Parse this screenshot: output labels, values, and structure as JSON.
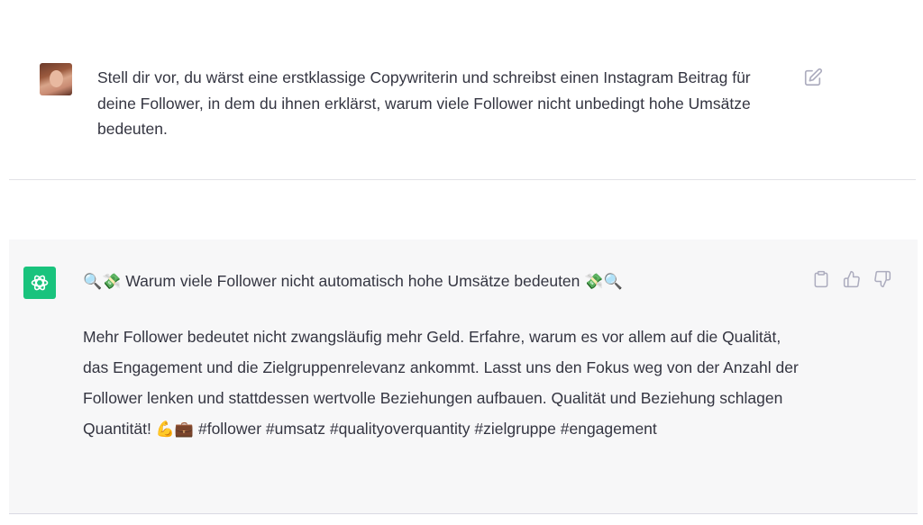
{
  "user_message": {
    "text": "Stell dir vor, du wärst eine erstklassige Copywriterin und schreibst einen Instagram Beitrag für deine Follower, in dem du ihnen erklärst, warum viele Follower nicht unbedingt hohe Umsätze bedeuten."
  },
  "assistant_message": {
    "title_emoji_left": "🔍💸",
    "title_text": "Warum viele Follower nicht automatisch hohe Umsätze bedeuten",
    "title_emoji_right": "💸🔍",
    "body_text": "Mehr Follower bedeutet nicht zwangsläufig mehr Geld. Erfahre, warum es vor allem auf die Qualität, das Engagement und die Zielgruppenrelevanz ankommt. Lasst uns den Fokus weg von der Anzahl der Follower lenken und stattdessen wertvolle Beziehungen aufbauen. Qualität und Beziehung schlagen Quantität!",
    "body_emojis": "💪💼",
    "hashtags": "#follower #umsatz #qualityoverquantity #zielgruppe #engagement"
  },
  "icons": {
    "user_avatar": "user-avatar-photo",
    "bot_avatar": "openai-logo-icon",
    "edit": "edit-icon",
    "copy": "clipboard-icon",
    "like": "thumbs-up-icon",
    "dislike": "thumbs-down-icon"
  },
  "colors": {
    "bot_avatar_bg": "#19c37d",
    "assistant_row_bg": "#f7f7f8",
    "text": "#343541",
    "icon": "#acacbe"
  }
}
